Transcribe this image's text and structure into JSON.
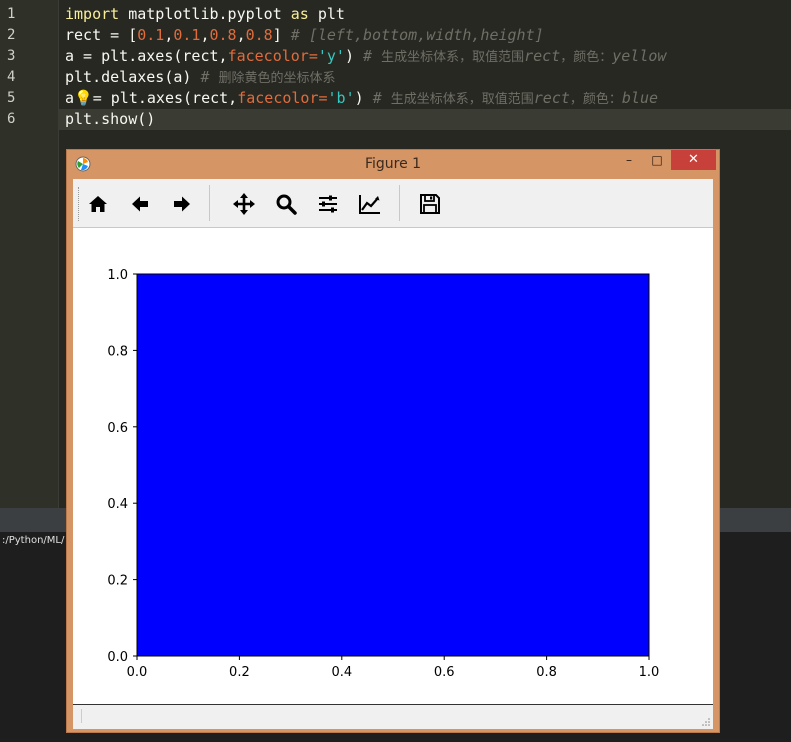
{
  "editor": {
    "line_numbers": [
      "1",
      "2",
      "3",
      "4",
      "5",
      "6"
    ],
    "lines": [
      {
        "tokens": [
          {
            "c": "kw2",
            "t": "import"
          },
          {
            "c": "kw",
            "t": " matplotlib.pyplot "
          },
          {
            "c": "kw2",
            "t": "as"
          },
          {
            "c": "kw",
            "t": " plt"
          }
        ]
      },
      {
        "tokens": [
          {
            "c": "kw",
            "t": "rect = ["
          },
          {
            "c": "num",
            "t": "0.1"
          },
          {
            "c": "kw",
            "t": ","
          },
          {
            "c": "num",
            "t": "0.1"
          },
          {
            "c": "kw",
            "t": ","
          },
          {
            "c": "num",
            "t": "0.8"
          },
          {
            "c": "kw",
            "t": ","
          },
          {
            "c": "num",
            "t": "0.8"
          },
          {
            "c": "kw",
            "t": "] "
          },
          {
            "c": "cmt",
            "t": "# [left,bottom,width,height]"
          }
        ]
      },
      {
        "tokens": [
          {
            "c": "kw",
            "t": "a = plt.axes(rect,"
          },
          {
            "c": "param",
            "t": "facecolor="
          },
          {
            "c": "str",
            "t": "'y'"
          },
          {
            "c": "kw",
            "t": ") "
          },
          {
            "c": "cmt",
            "t": "# "
          },
          {
            "c": "cmt-cn",
            "t": "生成坐标体系，取值范围"
          },
          {
            "c": "cmt",
            "t": "rect"
          },
          {
            "c": "cmt-cn",
            "t": "，颜色："
          },
          {
            "c": "cmt",
            "t": "yellow"
          }
        ]
      },
      {
        "tokens": [
          {
            "c": "kw",
            "t": "plt.delaxes(a) "
          },
          {
            "c": "cmt",
            "t": "# "
          },
          {
            "c": "cmt-cn",
            "t": "删除黄色的坐标体系"
          }
        ]
      },
      {
        "tokens": [
          {
            "c": "kw",
            "t": "a"
          },
          {
            "c": "bulb",
            "t": "💡"
          },
          {
            "c": "kw",
            "t": "= plt.axes(rect,"
          },
          {
            "c": "param",
            "t": "facecolor="
          },
          {
            "c": "str",
            "t": "'b'"
          },
          {
            "c": "kw",
            "t": ") "
          },
          {
            "c": "cmt",
            "t": "# "
          },
          {
            "c": "cmt-cn",
            "t": "生成坐标体系，取值范围"
          },
          {
            "c": "cmt",
            "t": "rect"
          },
          {
            "c": "cmt-cn",
            "t": "，颜色："
          },
          {
            "c": "cmt",
            "t": "blue"
          }
        ]
      },
      {
        "tokens": [
          {
            "c": "kw",
            "t": "plt.show()"
          }
        ]
      }
    ]
  },
  "console": {
    "path_text": ":/Python/ML/"
  },
  "figure_window": {
    "title": "Figure 1",
    "minimize_label": "–",
    "maximize_label": "□",
    "close_label": "✕",
    "toolbar": [
      {
        "name": "home-icon",
        "label": "Home"
      },
      {
        "name": "back-arrow-icon",
        "label": "Back"
      },
      {
        "name": "forward-arrow-icon",
        "label": "Forward"
      },
      {
        "name": "pan-icon",
        "label": "Pan"
      },
      {
        "name": "zoom-icon",
        "label": "Zoom"
      },
      {
        "name": "configure-subplots-icon",
        "label": "Subplots"
      },
      {
        "name": "edit-axis-icon",
        "label": "Customize"
      },
      {
        "name": "save-icon",
        "label": "Save"
      }
    ]
  },
  "chart_data": {
    "type": "area",
    "facecolor": "#0000ff",
    "xlim": [
      0.0,
      1.0
    ],
    "ylim": [
      0.0,
      1.0
    ],
    "xticks": [
      "0.0",
      "0.2",
      "0.4",
      "0.6",
      "0.8",
      "1.0"
    ],
    "yticks": [
      "0.0",
      "0.2",
      "0.4",
      "0.6",
      "0.8",
      "1.0"
    ],
    "title": "",
    "xlabel": "",
    "ylabel": "",
    "grid": false
  }
}
